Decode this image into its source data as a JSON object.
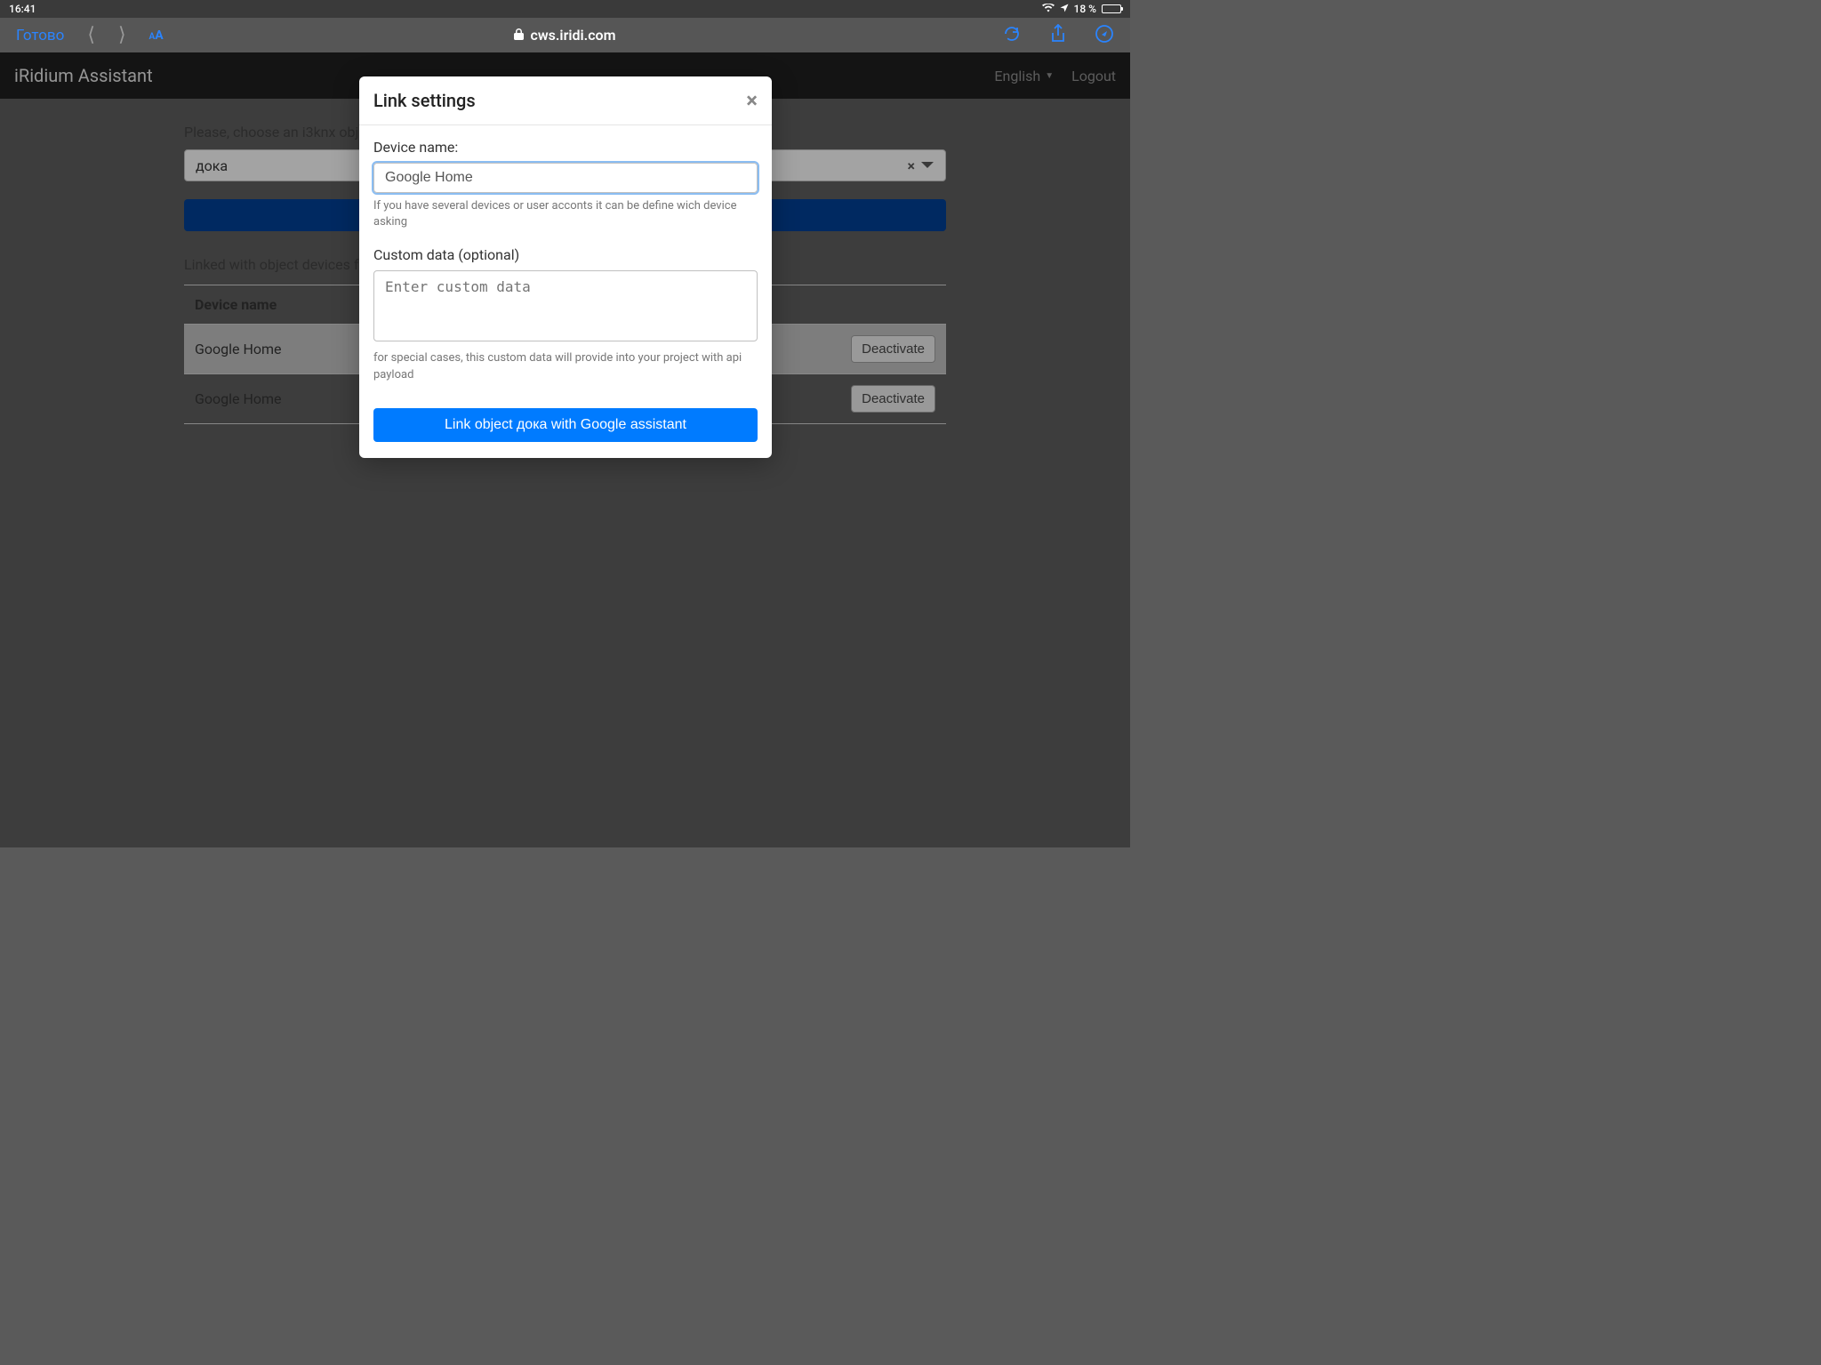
{
  "status_bar": {
    "time": "16:41",
    "battery_pct": "18 %"
  },
  "safari": {
    "done": "Готово",
    "domain": "cws.iridi.com"
  },
  "header": {
    "title": "iRidium Assistant",
    "language": "English",
    "logout": "Logout"
  },
  "page": {
    "choose_label": "Please, choose an i3knx obje",
    "selected_object": "дока",
    "linked_label": "Linked with object devices fo",
    "table": {
      "col_device": "Device name",
      "deact": "Deactivate",
      "rows": [
        {
          "name": "Google Home"
        },
        {
          "name": "Google Home"
        }
      ]
    }
  },
  "modal": {
    "title": "Link settings",
    "device_name_label": "Device name:",
    "device_name_value": "Google Home",
    "device_name_help": "If you have several devices or user acconts it can be define wich device asking",
    "custom_data_label": "Custom data (optional)",
    "custom_data_placeholder": "Enter custom data",
    "custom_data_help": "for special cases, this custom data will provide into your project with api payload",
    "submit": "Link object дока with Google assistant"
  }
}
